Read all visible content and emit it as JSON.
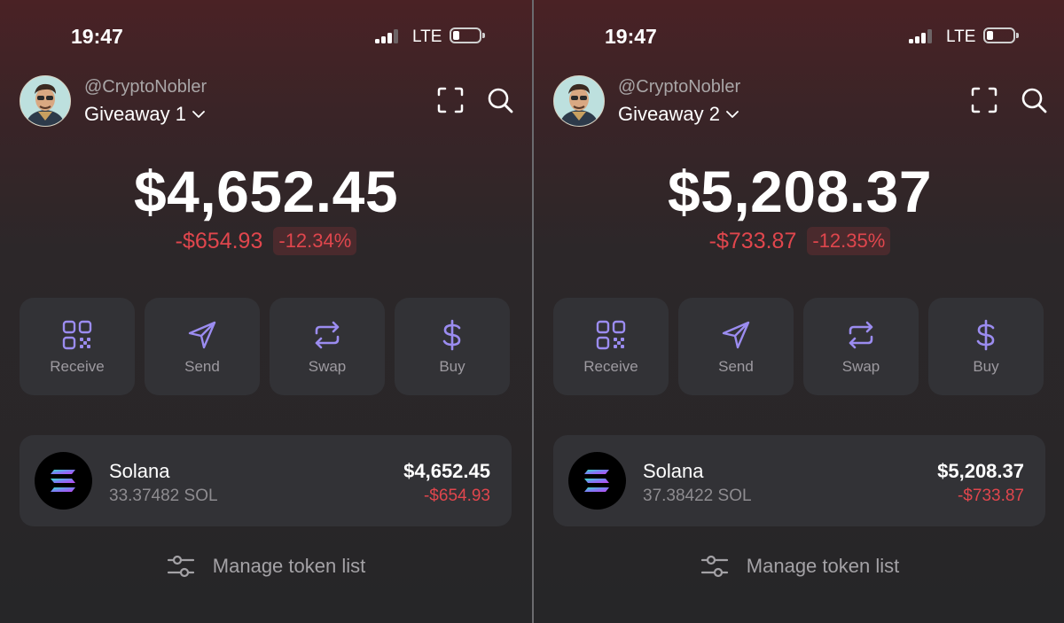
{
  "colors": {
    "accent": "#9b8cf0",
    "negative": "#e0464d",
    "card": "#323236"
  },
  "screens": [
    {
      "status": {
        "time": "19:47",
        "network": "LTE"
      },
      "header": {
        "handle": "@CryptoNobler",
        "account": "Giveaway 1"
      },
      "balance": {
        "total": "$4,652.45",
        "change_abs": "-$654.93",
        "change_pct": "-12.34%"
      },
      "actions": [
        {
          "label": "Receive",
          "icon": "qr-code-icon"
        },
        {
          "label": "Send",
          "icon": "send-icon"
        },
        {
          "label": "Swap",
          "icon": "swap-icon"
        },
        {
          "label": "Buy",
          "icon": "dollar-icon"
        }
      ],
      "token": {
        "name": "Solana",
        "amount": "33.37482 SOL",
        "value": "$4,652.45",
        "change": "-$654.93",
        "icon": "solana-icon"
      },
      "manage_label": "Manage token list"
    },
    {
      "status": {
        "time": "19:47",
        "network": "LTE"
      },
      "header": {
        "handle": "@CryptoNobler",
        "account": "Giveaway 2"
      },
      "balance": {
        "total": "$5,208.37",
        "change_abs": "-$733.87",
        "change_pct": "-12.35%"
      },
      "actions": [
        {
          "label": "Receive",
          "icon": "qr-code-icon"
        },
        {
          "label": "Send",
          "icon": "send-icon"
        },
        {
          "label": "Swap",
          "icon": "swap-icon"
        },
        {
          "label": "Buy",
          "icon": "dollar-icon"
        }
      ],
      "token": {
        "name": "Solana",
        "amount": "37.38422 SOL",
        "value": "$5,208.37",
        "change": "-$733.87",
        "icon": "solana-icon"
      },
      "manage_label": "Manage token list"
    }
  ]
}
